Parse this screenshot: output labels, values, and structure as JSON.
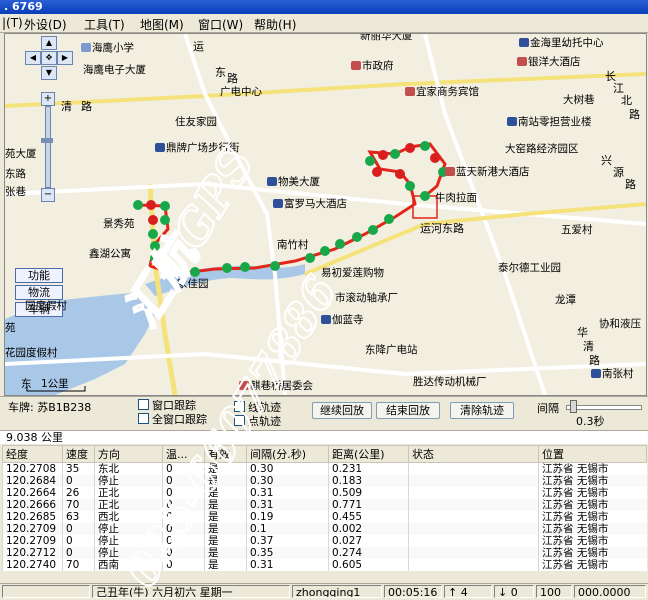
{
  "window": {
    "title": ". 6769"
  },
  "menu": [
    {
      "label": "|(T)"
    },
    {
      "label": "外设(D)"
    },
    {
      "label": "工具(T)"
    },
    {
      "label": "地图(M)"
    },
    {
      "label": "窗口(W)"
    },
    {
      "label": "帮助(H)"
    }
  ],
  "map": {
    "scale_label": "1公里",
    "compass_label": "东",
    "labels": [
      {
        "text": "海鹰小学"
      },
      {
        "text": "海鹰电子大厦"
      },
      {
        "text": "运"
      },
      {
        "text": "东"
      },
      {
        "text": "路"
      },
      {
        "text": "广电中心"
      },
      {
        "text": "新丽华大厦"
      },
      {
        "text": "市政府"
      },
      {
        "text": "宜家商务宾馆"
      },
      {
        "text": "金海里幼托中心"
      },
      {
        "text": "银洋大酒店"
      },
      {
        "text": "长"
      },
      {
        "text": "江"
      },
      {
        "text": "北"
      },
      {
        "text": "路"
      },
      {
        "text": "大树巷"
      },
      {
        "text": "南站零担营业楼"
      },
      {
        "text": "大窑路经济园区"
      },
      {
        "text": "住友家园"
      },
      {
        "text": "鼎牌广场步行街"
      },
      {
        "text": "清"
      },
      {
        "text": "路"
      },
      {
        "text": "物美大厦"
      },
      {
        "text": "蓝天新港大酒店"
      },
      {
        "text": "富罗马大酒店"
      },
      {
        "text": "牛肉拉面"
      },
      {
        "text": "运河东路"
      },
      {
        "text": "五爱村"
      },
      {
        "text": "景秀苑"
      },
      {
        "text": "南竹村"
      },
      {
        "text": "鑫湖公寓"
      },
      {
        "text": "易初爱莲购物"
      },
      {
        "text": "泰尔德工业园"
      },
      {
        "text": "家佳园"
      },
      {
        "text": "市滚动轴承厂"
      },
      {
        "text": "龙潭"
      },
      {
        "text": "伽蓝寺"
      },
      {
        "text": "协和液压"
      },
      {
        "text": "东降广电站"
      },
      {
        "text": "华"
      },
      {
        "text": "清"
      },
      {
        "text": "路"
      },
      {
        "text": "胜达传动机械厂"
      },
      {
        "text": "南张村"
      },
      {
        "text": "麒巷桥居委会"
      },
      {
        "text": "花园度假村"
      },
      {
        "text": "园度假村"
      },
      {
        "text": "苑大厦"
      },
      {
        "text": "张巷"
      },
      {
        "text": "东路"
      },
      {
        "text": "兴"
      },
      {
        "text": "源"
      },
      {
        "text": "路"
      },
      {
        "text": "苑"
      }
    ],
    "side_buttons": [
      "功能",
      "物流",
      "车辆"
    ]
  },
  "controls": {
    "plate": "车牌: 苏B1B238",
    "window_track": "窗口跟踪",
    "full_track": "全窗口跟踪",
    "line_track": "线轨迹",
    "point_track": "点轨迹",
    "continue_btn": "继续回放",
    "end_btn": "结束回放",
    "clear_btn": "清除轨迹",
    "interval_label": "间隔",
    "interval_value": "0.3秒"
  },
  "summary": "9.038 公里",
  "table": {
    "headers": [
      "经度",
      "速度",
      "方向",
      "温...",
      "有效",
      "间隔(分.秒)",
      "距离(公里)",
      "状态",
      "位置"
    ],
    "rows": [
      [
        "120.2708",
        "35",
        "东北",
        "0",
        "是",
        "0.30",
        "0.231",
        "",
        "江苏省 无锡市"
      ],
      [
        "120.2684",
        "0",
        "停止",
        "0",
        "是",
        "0.30",
        "0.183",
        "",
        "江苏省 无锡市"
      ],
      [
        "120.2664",
        "26",
        "正北",
        "0",
        "是",
        "0.31",
        "0.509",
        "",
        "江苏省 无锡市"
      ],
      [
        "120.2666",
        "70",
        "正北",
        "0",
        "是",
        "0.31",
        "0.771",
        "",
        "江苏省 无锡市"
      ],
      [
        "120.2685",
        "63",
        "西北",
        "0",
        "是",
        "0.19",
        "0.455",
        "",
        "江苏省 无锡市"
      ],
      [
        "120.2709",
        "0",
        "停止",
        "0",
        "是",
        "0.1",
        "0.002",
        "",
        "江苏省 无锡市"
      ],
      [
        "120.2709",
        "0",
        "停止",
        "0",
        "是",
        "0.37",
        "0.027",
        "",
        "江苏省 无锡市"
      ],
      [
        "120.2712",
        "0",
        "停止",
        "0",
        "是",
        "0.35",
        "0.274",
        "",
        "江苏省 无锡市"
      ],
      [
        "120.2740",
        "70",
        "西南",
        "0",
        "是",
        "0.31",
        "0.605",
        "",
        "江苏省 无锡市"
      ]
    ]
  },
  "status": {
    "date": "己丑年(牛) 六月初六 星期一",
    "user": "zhongqing1",
    "time": "00:05:16",
    "up_count": "4",
    "down_count": "0",
    "value1": "100",
    "value2": "000.0000"
  },
  "watermark": {
    "brand": "汇航GPS",
    "phone": "025-66077886"
  },
  "colors": {
    "route": "#e2261b",
    "marker_green": "#18a84a",
    "marker_red": "#d81e1e",
    "water": "#a9c8e8",
    "road_yellow": "#f6e27a",
    "titlebar": "#0a3db8"
  }
}
